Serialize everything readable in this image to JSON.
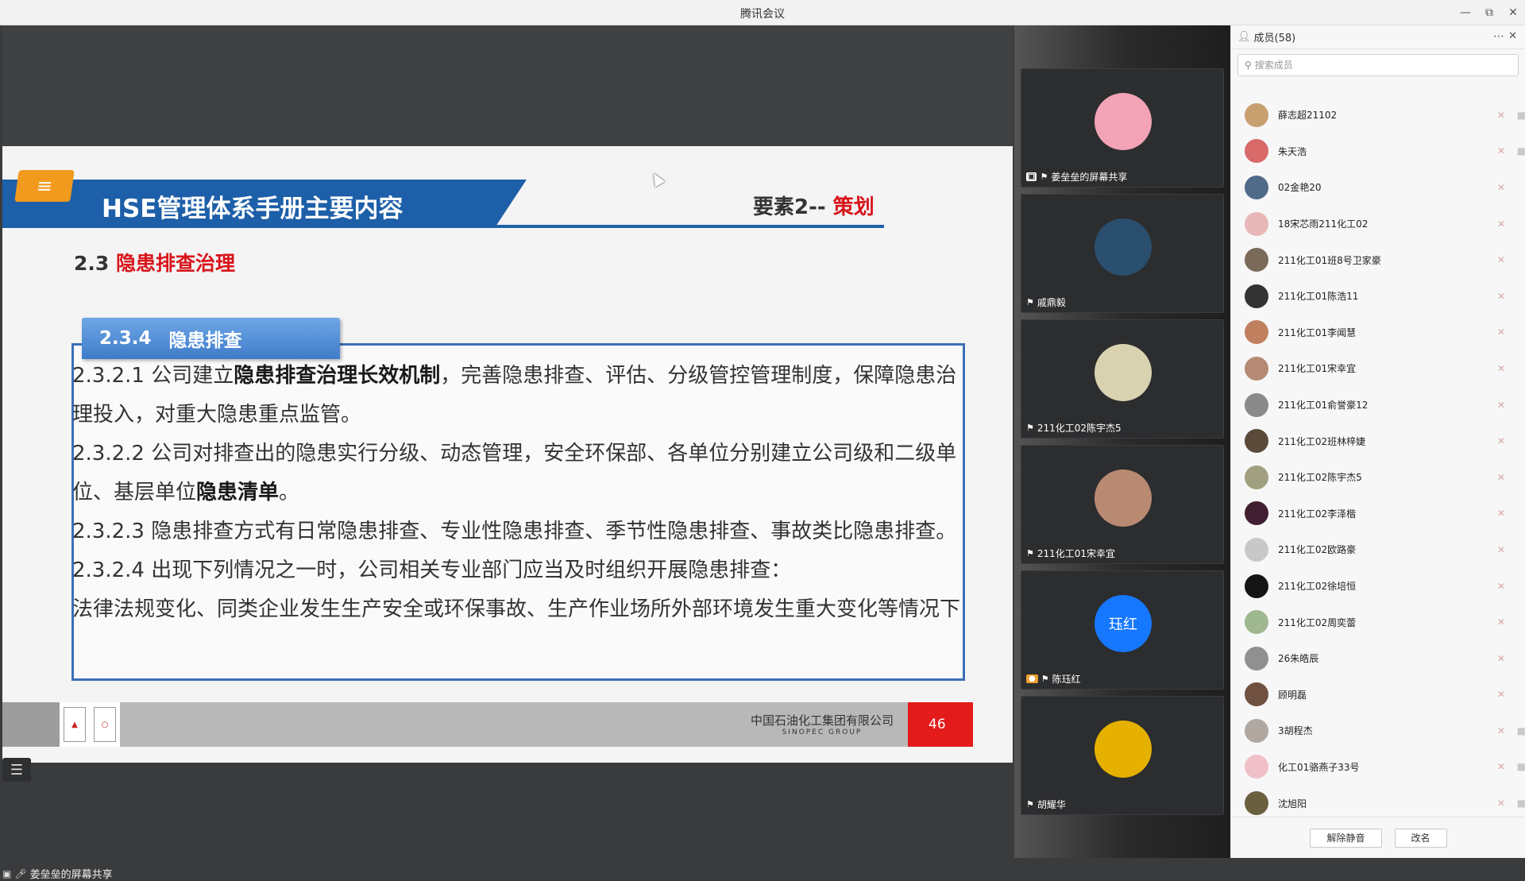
{
  "window": {
    "title": "腾讯会议"
  },
  "slide": {
    "tag_icon": "≡",
    "title": "HSE管理体系手册主要内容",
    "element_prefix": "要素2-- ",
    "element_highlight": "策划",
    "section_num": "2.3 ",
    "section_title": "隐患排查治理",
    "sub_num": "2.3.4",
    "sub_title": "隐患排查",
    "p1a": "2.3.2.1 公司建立",
    "p1b": "隐患排查治理长效机制",
    "p1c": "，完善隐患排查、评估、分级管控管理制度，保障隐患治理投入，对重大隐患重点监管。",
    "p2a": "2.3.2.2 公司对排查出的隐患实行分级、动态管理，安全环保部、各单位分别建立公司级和二级单位、基层单位",
    "p2b": "隐患清单",
    "p2c": "。",
    "p3": "2.3.2.3 隐患排查方式有日常隐患排查、专业性隐患排查、季节性隐患排查、事故类比隐患排查。",
    "p4": "2.3.2.4 出现下列情况之一时，公司相关专业部门应当及时组织开展隐患排查：",
    "p5": "法律法规变化、同类企业发生生产安全或环保事故、生产作业场所外部环境发生重大变化等情况下",
    "footer_company": "中国石油化工集团有限公司",
    "footer_company_en": "SINOPEC GROUP",
    "page_number": "46"
  },
  "share_label": "姜垒垒的屏幕共享",
  "video_tiles": [
    {
      "name": "姜垒垒的屏幕共享",
      "kind": "screen",
      "color": "#f2a3b5"
    },
    {
      "name": "戚鼎毅",
      "kind": "normal",
      "color": "#2a4f6e"
    },
    {
      "name": "211化工02陈宇杰5",
      "kind": "normal",
      "color": "#d9d2b0"
    },
    {
      "name": "211化工01宋幸宜",
      "kind": "normal",
      "color": "#b98a72"
    },
    {
      "name": "陈珏红",
      "kind": "person",
      "color": "#1677ff",
      "initials": "珏红"
    },
    {
      "name": "胡耀华",
      "kind": "normal",
      "color": "#e5b000"
    }
  ],
  "panel": {
    "title": "成员(58)",
    "search_placeholder": "搜索成员",
    "unmute_all": "解除静音",
    "rename": "改名"
  },
  "members": [
    {
      "name": "薛志超21102",
      "color": "#c8a070",
      "cam": true
    },
    {
      "name": "朱天浩",
      "color": "#d86a6a",
      "cam": true
    },
    {
      "name": "02金艳20",
      "color": "#506a8a",
      "cam": false
    },
    {
      "name": "18宋芯雨211化工02",
      "color": "#e8b8b8",
      "cam": false
    },
    {
      "name": "211化工01班8号卫家豪",
      "color": "#7a6a5a",
      "cam": false
    },
    {
      "name": "211化工01陈浩11",
      "color": "#333333",
      "cam": false
    },
    {
      "name": "211化工01李闻慧",
      "color": "#c08060",
      "cam": false
    },
    {
      "name": "211化工01宋幸宜",
      "color": "#b58a75",
      "cam": false
    },
    {
      "name": "211化工01俞誉豪12",
      "color": "#8a8a8a",
      "cam": false
    },
    {
      "name": "211化工02班林梓婕",
      "color": "#5a4a3a",
      "cam": false
    },
    {
      "name": "211化工02陈宇杰5",
      "color": "#a0a080",
      "cam": false
    },
    {
      "name": "211化工02李泽楷",
      "color": "#402030",
      "cam": false
    },
    {
      "name": "211化工02欧路豪",
      "color": "#c8c8c8",
      "cam": false
    },
    {
      "name": "211化工02徐培恒",
      "color": "#151515",
      "cam": false
    },
    {
      "name": "211化工02周奕蕾",
      "color": "#a0b890",
      "cam": false
    },
    {
      "name": "26朱皓辰",
      "color": "#909090",
      "cam": false
    },
    {
      "name": "顾明磊",
      "color": "#705040",
      "cam": false
    },
    {
      "name": "3胡程杰",
      "color": "#b0a8a0",
      "cam": true
    },
    {
      "name": "化工01骆燕子33号",
      "color": "#f0c0c8",
      "cam": true
    },
    {
      "name": "沈旭阳",
      "color": "#6a6040",
      "cam": true
    }
  ]
}
